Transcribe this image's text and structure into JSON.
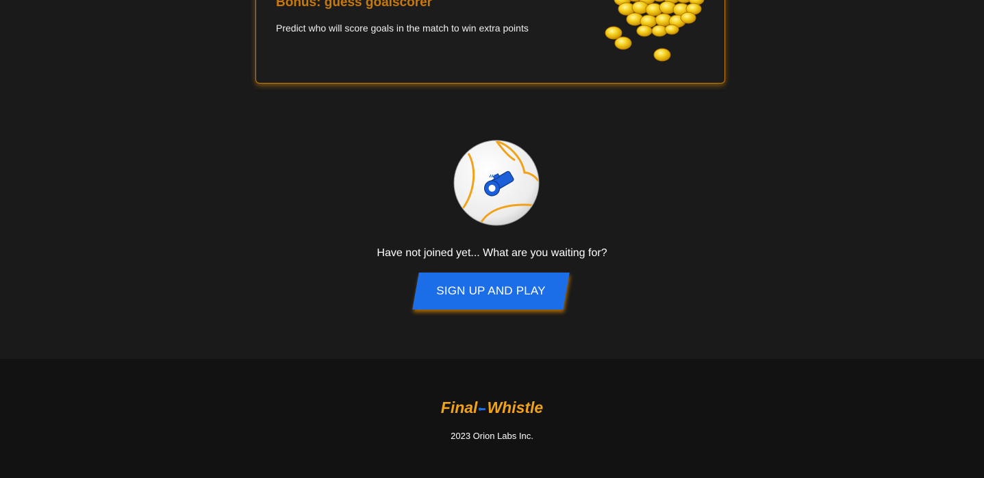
{
  "bonus": {
    "title": "Bonus: guess goalscorer",
    "description": "Predict who will score goals in the match to win extra points",
    "image": "gold-coins-pile"
  },
  "cta": {
    "icon": "ball-whistle-icon",
    "message": "Have not joined yet... What are you waiting for?",
    "button_label": "SIGN UP AND PLAY"
  },
  "footer": {
    "logo_part1": "Final",
    "logo_part2": "Whistle",
    "copyright": "2023 Orion Labs Inc."
  },
  "colors": {
    "accent_orange": "#f0a21a",
    "card_border": "#c27a00",
    "button_blue": "#1c6ee8",
    "background": "#1a1a1a",
    "footer_background": "#121212"
  }
}
